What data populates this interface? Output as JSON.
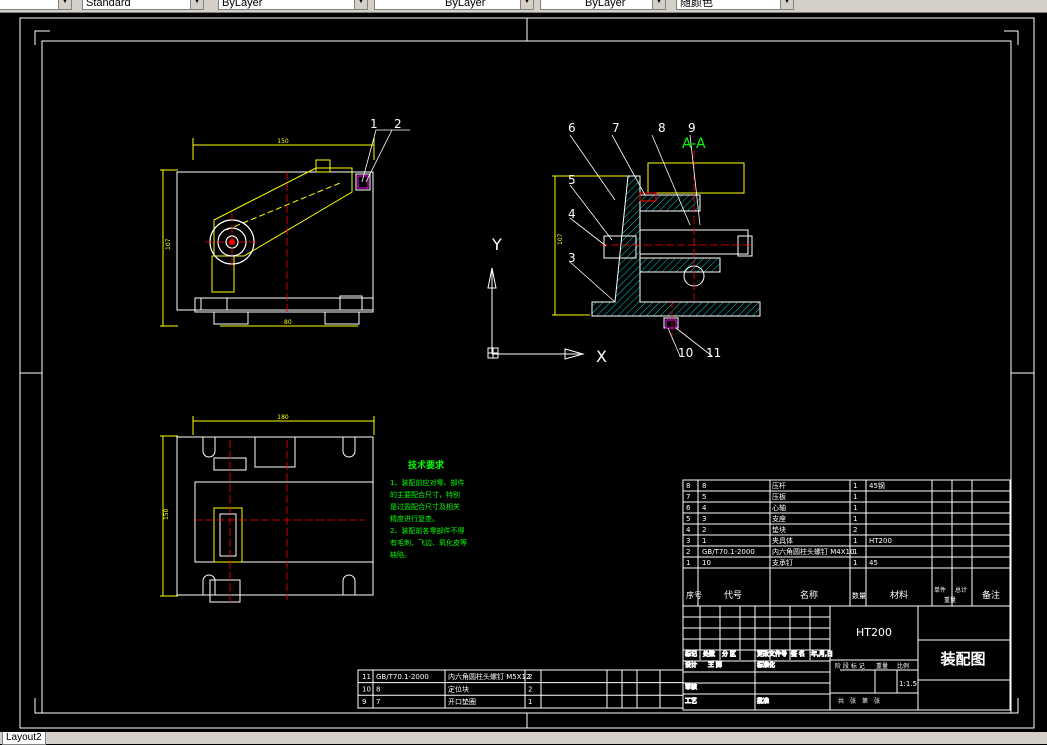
{
  "toolbar": {
    "text_style": "Standard",
    "layer": "ByLayer",
    "linetype": "ByLayer",
    "lineweight": "ByLayer",
    "color": "随颜色"
  },
  "drawing": {
    "axis_labels": {
      "y": "Y",
      "x": "X"
    },
    "section_label": "A-A",
    "dims": {
      "top_width": "150",
      "top_height": "107",
      "top_inner": "80",
      "side_height": "107",
      "plan_width": "180",
      "plan_height": "150"
    },
    "callouts": [
      "1",
      "2",
      "3",
      "4",
      "5",
      "6",
      "7",
      "8",
      "9",
      "10",
      "11"
    ],
    "tech_title": "技术要求",
    "tech_notes": [
      "1、装配前应对零、部件",
      "的主要配合尺寸，特别",
      "是过盈配合尺寸及相关",
      "精度进行复查。",
      "2、装配前各零部件不得",
      "有毛刺、飞边、氧化皮等",
      "缺陷。"
    ],
    "bom_rows": [
      {
        "seq": "8",
        "code": "8",
        "name": "压杆",
        "qty": "1",
        "material": "45钢"
      },
      {
        "seq": "7",
        "code": "5",
        "name": "压板",
        "qty": "1",
        "material": ""
      },
      {
        "seq": "6",
        "code": "4",
        "name": "心轴",
        "qty": "1",
        "material": ""
      },
      {
        "seq": "5",
        "code": "3",
        "name": "支座",
        "qty": "1",
        "material": ""
      },
      {
        "seq": "4",
        "code": "2",
        "name": "垫块",
        "qty": "2",
        "material": ""
      },
      {
        "seq": "3",
        "code": "1",
        "name": "夹具体",
        "qty": "1",
        "material": "HT200"
      },
      {
        "seq": "2",
        "code": "GB/T70.1-2000",
        "name": "内六角圆柱头螺钉 M4X10",
        "qty": "1",
        "material": ""
      },
      {
        "seq": "1",
        "code": "10",
        "name": "支承钉",
        "qty": "1",
        "material": "45"
      }
    ],
    "bom_header": {
      "seq": "序号",
      "code": "代号",
      "name": "名称",
      "qty": "数量",
      "material": "材料",
      "unit_weight": "单件",
      "total_weight": "总计",
      "weight": "重量",
      "remark": "备注"
    },
    "lower_rows": [
      {
        "seq": "11",
        "code": "GB/T70.1-2000",
        "name": "内六角圆柱头螺钉 M5X12",
        "qty": "2"
      },
      {
        "seq": "10",
        "code": "8",
        "name": "定位块",
        "qty": "2"
      },
      {
        "seq": "9",
        "code": "7",
        "name": "开口垫圈",
        "qty": "1"
      }
    ],
    "title_block": {
      "material": "HT200",
      "title": "装配图",
      "scale": "1:1.5",
      "row_mark": "标记",
      "row_count": "处数",
      "row_zone": "分 区",
      "row_doc": "更改文件号",
      "row_sign": "签 名",
      "row_date": "年,月,日",
      "designer_label": "设计",
      "designer": "王 辉",
      "std_label": "标准化",
      "check_label": "审核",
      "process_label": "工艺",
      "approve_label": "批准",
      "stage_label": "阶 段 标 记",
      "weight_label": "重量",
      "scale_label": "比例",
      "sheets": "共　张　第　张"
    }
  },
  "layout_tab": "Layout2"
}
